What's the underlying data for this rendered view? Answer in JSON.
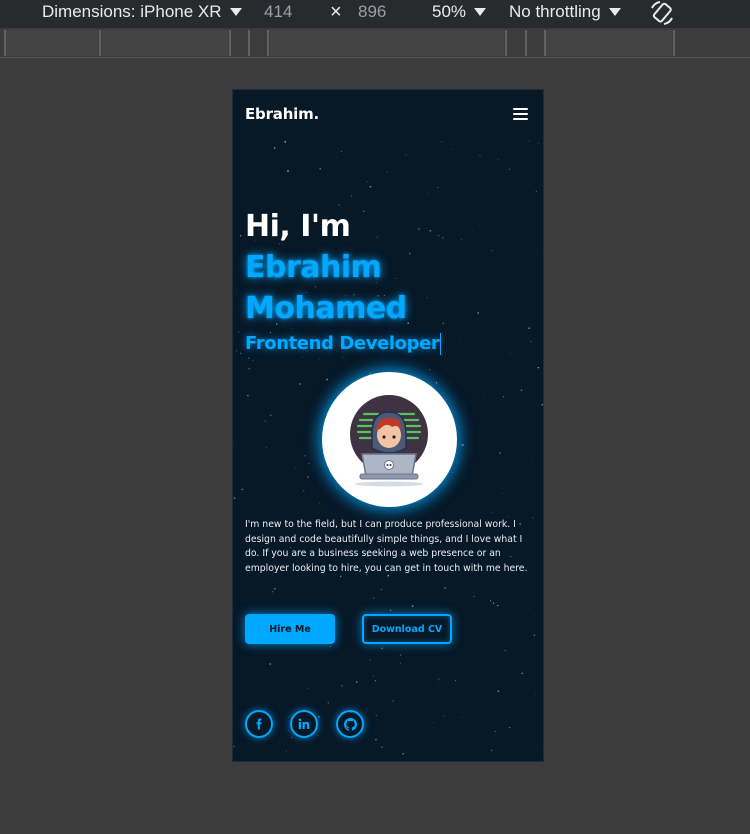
{
  "devtools": {
    "device_label": "Dimensions: iPhone XR",
    "width": "414",
    "times": "×",
    "height": "896",
    "zoom": "50%",
    "throttling": "No throttling",
    "rotate_icon": "rotate-icon"
  },
  "nav": {
    "brand": "Ebrahim.",
    "menu_icon": "hamburger-menu-icon"
  },
  "hero": {
    "greeting": "Hi, I'm",
    "first_name": "Ebrahim",
    "last_name": "Mohamed",
    "role": "Frontend Developer"
  },
  "bio": "I'm new to the field, but I can produce professional work. I design and code beautifully simple things, and I love what I do. If you are a business seeking a web presence or an employer looking to hire, you can get in touch with me here.",
  "buttons": {
    "hire": "Hire Me",
    "cv": "Download CV"
  },
  "social": [
    {
      "icon": "facebook-icon"
    },
    {
      "icon": "linkedin-icon"
    },
    {
      "icon": "github-icon"
    }
  ],
  "colors": {
    "accent": "#00a8ff",
    "background": "#071827",
    "devtools_bar": "#292a2d",
    "page_bg": "#3c3c3c"
  }
}
